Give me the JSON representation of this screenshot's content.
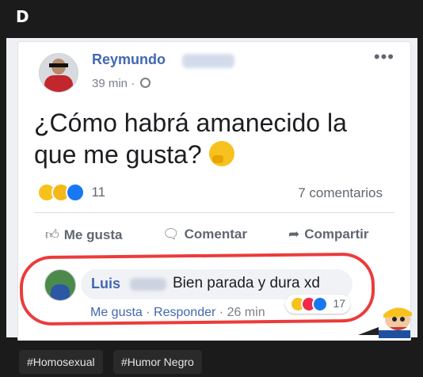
{
  "header": {
    "title": "D"
  },
  "post": {
    "author": "Reymundo",
    "time": "39 min ·",
    "more": "•••",
    "text": "¿Cómo habrá amanecido la que me gusta?",
    "reaction_count": "11",
    "comments_count": "7 comentarios",
    "actions": {
      "like": "Me gusta",
      "comment": "Comentar",
      "share": "Compartir"
    }
  },
  "comment": {
    "author": "Luis",
    "text": "Bien parada y dura xd",
    "like": "Me gusta",
    "reply": "Responder",
    "time": "26 min",
    "reaction_count": "17"
  },
  "tags": [
    "#Homosexual",
    "#Humor Negro"
  ],
  "colors": {
    "background": "#1b1b1b",
    "facebook_blue": "#4267b2",
    "highlight_red": "#ec3b3b",
    "tag_bg": "#2a2a2a"
  }
}
